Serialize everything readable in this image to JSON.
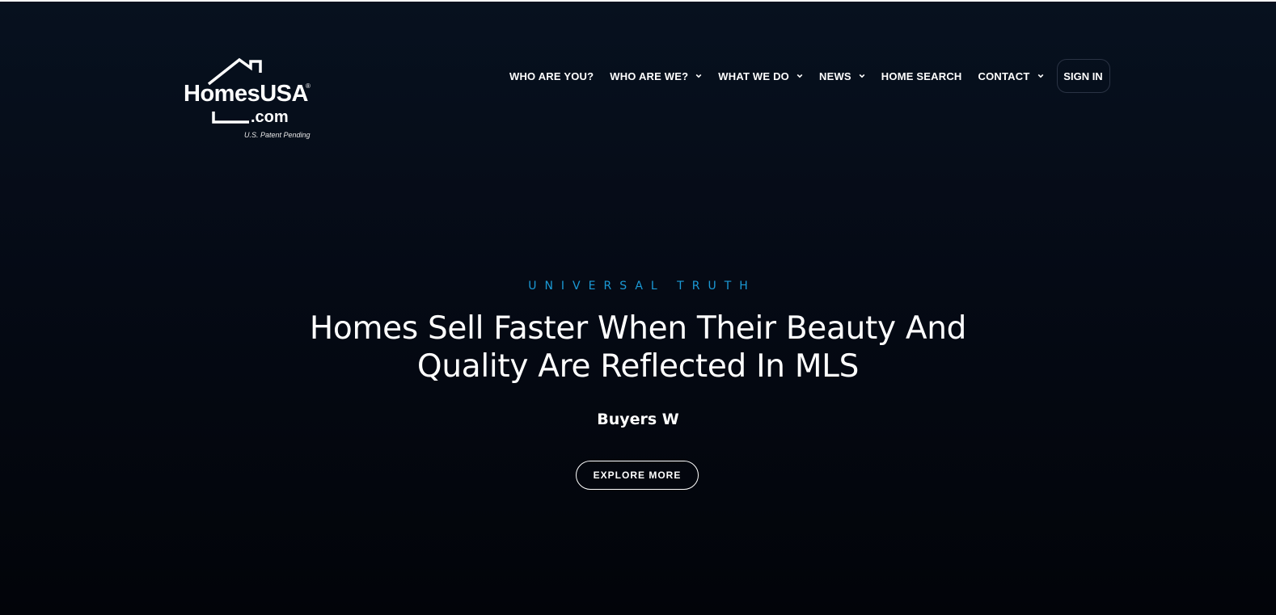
{
  "logo": {
    "brand": "HomesUSA",
    "registered": "®",
    "domain": ".com",
    "patent": "U.S. Patent Pending"
  },
  "nav": {
    "items": [
      {
        "label": "WHO ARE YOU?",
        "icon": null
      },
      {
        "label": "WHO ARE WE?",
        "icon": "chevron-down-icon"
      },
      {
        "label": "WHAT WE DO",
        "icon": "chevron-down-icon"
      },
      {
        "label": "NEWS",
        "icon": "chevron-down-icon"
      },
      {
        "label": "HOME SEARCH",
        "icon": null
      },
      {
        "label": "CONTACT",
        "icon": "chevron-down-icon"
      }
    ],
    "signin_label": "SIGN IN"
  },
  "hero": {
    "eyebrow": "UNIVERSAL TRUTH",
    "headline_line1": "Homes Sell Faster When Their Beauty And",
    "headline_line2": "Quality Are Reflected In MLS",
    "typed_text": "Buyers W",
    "cta_label": "EXPLORE MORE"
  },
  "colors": {
    "background_top": "#07111f",
    "background_bottom": "#020409",
    "accent": "#1b9ad6",
    "text": "#ffffff"
  }
}
